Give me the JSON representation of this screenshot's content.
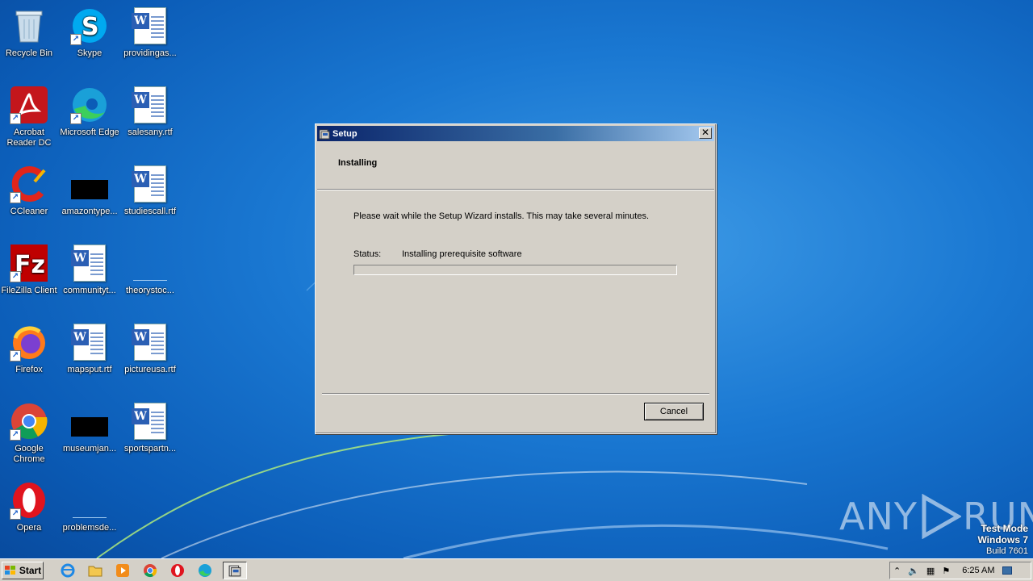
{
  "desktop": {
    "icons": [
      {
        "label": "Recycle Bin"
      },
      {
        "label": "Skype"
      },
      {
        "label": "providingas..."
      },
      {
        "label": "Acrobat Reader DC"
      },
      {
        "label": "Microsoft Edge"
      },
      {
        "label": "salesany.rtf"
      },
      {
        "label": "CCleaner"
      },
      {
        "label": "amazontype..."
      },
      {
        "label": "studiescall.rtf"
      },
      {
        "label": "FileZilla Client"
      },
      {
        "label": "communityt..."
      },
      {
        "label": "theorystoc..."
      },
      {
        "label": "Firefox"
      },
      {
        "label": "mapsput.rtf"
      },
      {
        "label": "pictureusa.rtf"
      },
      {
        "label": "Google Chrome"
      },
      {
        "label": "museumjan..."
      },
      {
        "label": "sportspartn..."
      },
      {
        "label": "Opera"
      },
      {
        "label": "problemsde..."
      }
    ]
  },
  "window": {
    "title": "Setup",
    "close_glyph": "✕",
    "header_title": "Installing",
    "description": "Please wait while the Setup Wizard installs.  This may take several minutes.",
    "status_label": "Status:",
    "status_value": "Installing prerequisite software",
    "progress_fraction": 0.0,
    "cancel_label": "Cancel"
  },
  "watermark": {
    "left": "ANY",
    "right": "RUN",
    "test_mode": "Test Mode",
    "os": "Windows 7",
    "build": "Build 7601"
  },
  "taskbar": {
    "start_label": "Start",
    "clock": "6:25 AM"
  },
  "colors": {
    "title_start": "#0a246a",
    "title_end": "#a6caf0",
    "dialog_bg": "#d4d0c8"
  }
}
